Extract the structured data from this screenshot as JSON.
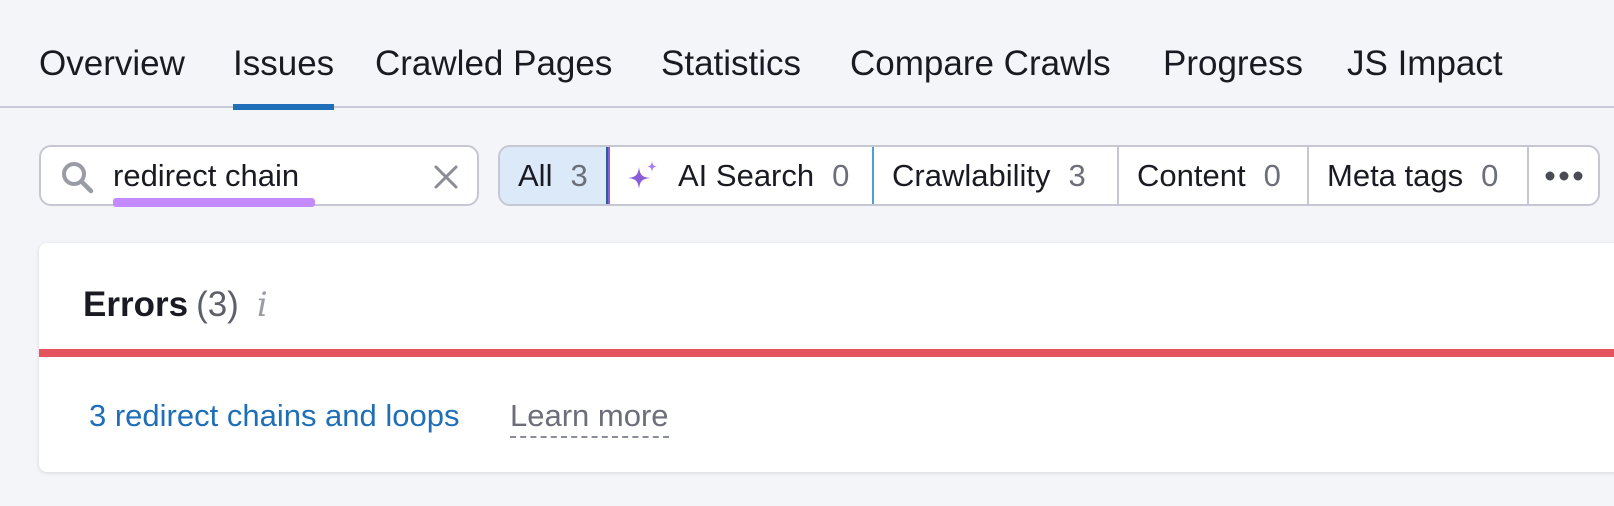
{
  "tabs": [
    {
      "label": "Overview",
      "active": false
    },
    {
      "label": "Issues",
      "active": true
    },
    {
      "label": "Crawled Pages",
      "active": false
    },
    {
      "label": "Statistics",
      "active": false
    },
    {
      "label": "Compare Crawls",
      "active": false
    },
    {
      "label": "Progress",
      "active": false
    },
    {
      "label": "JS Impact",
      "active": false
    }
  ],
  "search": {
    "value": "redirect chain",
    "icon": "search-icon",
    "clear_icon": "close-icon"
  },
  "filters": {
    "all": {
      "label": "All",
      "count": "3"
    },
    "ai_search": {
      "label": "AI Search",
      "count": "0",
      "icon": "sparkle-icon"
    },
    "crawlability": {
      "label": "Crawlability",
      "count": "3"
    },
    "content": {
      "label": "Content",
      "count": "0"
    },
    "meta_tags": {
      "label": "Meta tags",
      "count": "0"
    },
    "more_icon": "more-dots-icon"
  },
  "errors": {
    "title": "Errors",
    "count": "(3)",
    "info_glyph": "i",
    "issue_link": "3 redirect chains and loops",
    "learn_more": "Learn more"
  },
  "colors": {
    "accent": "#1f6fb8",
    "error": "#e5535c",
    "highlight": "#c38bff",
    "ai": "#8a5cd8"
  }
}
